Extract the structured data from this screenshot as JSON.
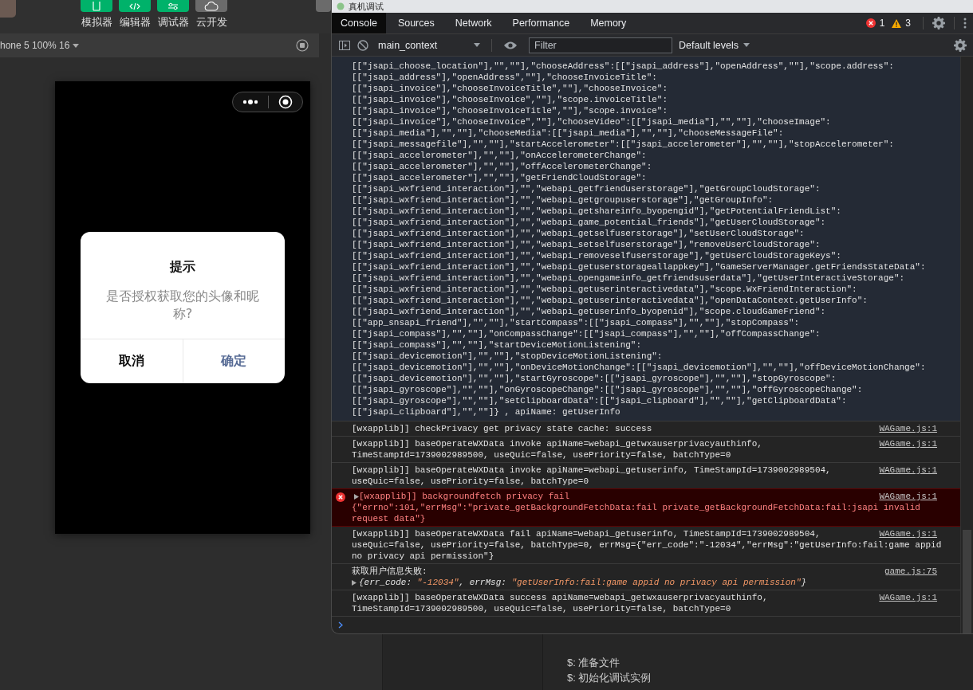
{
  "toolbar": {
    "buttons": [
      {
        "label": "模拟器",
        "on": true
      },
      {
        "label": "编辑器",
        "on": true
      },
      {
        "label": "调试器",
        "on": true
      },
      {
        "label": "云开发",
        "on": false
      }
    ]
  },
  "simulator": {
    "device_menu": "hone 5 100% 16"
  },
  "dialog": {
    "title": "提示",
    "message": "是否授权获取您的头像和昵称?",
    "cancel": "取消",
    "confirm": "确定"
  },
  "devtools": {
    "title": "真机调试",
    "tabs": [
      {
        "label": "Console",
        "selected": true
      },
      {
        "label": "Sources",
        "selected": false
      },
      {
        "label": "Network",
        "selected": false
      },
      {
        "label": "Performance",
        "selected": false
      },
      {
        "label": "Memory",
        "selected": false
      }
    ],
    "error_count": "1",
    "warning_count": "3",
    "context": "main_context",
    "filter": {
      "placeholder": "Filter"
    },
    "levels": "Default levels",
    "messages": [
      {
        "kind": "log",
        "selected": true,
        "lines": [
          "[[\"jsapi_choose_location\"],\"\",\"\"],\"chooseAddress\":[[\"jsapi_address\"],\"openAddress\",\"\"],\"scope.address\":",
          "[[\"jsapi_address\"],\"openAddress\",\"\"],\"chooseInvoiceTitle\":",
          "[[\"jsapi_invoice\"],\"chooseInvoiceTitle\",\"\"],\"chooseInvoice\":",
          "[[\"jsapi_invoice\"],\"chooseInvoice\",\"\"],\"scope.invoiceTitle\":",
          "[[\"jsapi_invoice\"],\"chooseInvoiceTitle\",\"\"],\"scope.invoice\":",
          "[[\"jsapi_invoice\"],\"chooseInvoice\",\"\"],\"chooseVideo\":[[\"jsapi_media\"],\"\",\"\"],\"chooseImage\":",
          "[[\"jsapi_media\"],\"\",\"\"],\"chooseMedia\":[[\"jsapi_media\"],\"\",\"\"],\"chooseMessageFile\":",
          "[[\"jsapi_messagefile\"],\"\",\"\"],\"startAccelerometer\":[[\"jsapi_accelerometer\"],\"\",\"\"],\"stopAccelerometer\":",
          "[[\"jsapi_accelerometer\"],\"\",\"\"],\"onAccelerometerChange\":",
          "[[\"jsapi_accelerometer\"],\"\",\"\"],\"offAccelerometerChange\":",
          "[[\"jsapi_accelerometer\"],\"\",\"\"],\"getFriendCloudStorage\":",
          "[[\"jsapi_wxfriend_interaction\"],\"\",\"webapi_getfrienduserstorage\"],\"getGroupCloudStorage\":",
          "[[\"jsapi_wxfriend_interaction\"],\"\",\"webapi_getgroupuserstorage\"],\"getGroupInfo\":",
          "[[\"jsapi_wxfriend_interaction\"],\"\",\"webapi_getshareinfo_byopengid\"],\"getPotentialFriendList\":",
          "[[\"jsapi_wxfriend_interaction\"],\"\",\"webapi_game_potential_friends\"],\"getUserCloudStorage\":",
          "[[\"jsapi_wxfriend_interaction\"],\"\",\"webapi_getselfuserstorage\"],\"setUserCloudStorage\":",
          "[[\"jsapi_wxfriend_interaction\"],\"\",\"webapi_setselfuserstorage\"],\"removeUserCloudStorage\":",
          "[[\"jsapi_wxfriend_interaction\"],\"\",\"webapi_removeselfuserstorage\"],\"getUserCloudStorageKeys\":",
          "[[\"jsapi_wxfriend_interaction\"],\"\",\"webapi_getuserstorageallappkey\"],\"GameServerManager.getFriendsStateData\":",
          "[[\"jsapi_wxfriend_interaction\"],\"\",\"webapi_opengameinfo_getfriendsuserdata\"],\"getUserInteractiveStorage\":",
          "[[\"jsapi_wxfriend_interaction\"],\"\",\"webapi_getuserinteractivedata\"],\"scope.WxFriendInteraction\":",
          "[[\"jsapi_wxfriend_interaction\"],\"\",\"webapi_getuserinteractivedata\"],\"openDataContext.getUserInfo\":",
          "[[\"jsapi_wxfriend_interaction\"],\"\",\"webapi_getuserinfo_byopenid\"],\"scope.cloudGameFriend\":",
          "[[\"app_snsapi_friend\"],\"\",\"\"],\"startCompass\":[[\"jsapi_compass\"],\"\",\"\"],\"stopCompass\":",
          "[[\"jsapi_compass\"],\"\",\"\"],\"onCompassChange\":[[\"jsapi_compass\"],\"\",\"\"],\"offCompassChange\":",
          "[[\"jsapi_compass\"],\"\",\"\"],\"startDeviceMotionListening\":",
          "[[\"jsapi_devicemotion\"],\"\",\"\"],\"stopDeviceMotionListening\":",
          "[[\"jsapi_devicemotion\"],\"\",\"\"],\"onDeviceMotionChange\":[[\"jsapi_devicemotion\"],\"\",\"\"],\"offDeviceMotionChange\":",
          "[[\"jsapi_devicemotion\"],\"\",\"\"],\"startGyroscope\":[[\"jsapi_gyroscope\"],\"\",\"\"],\"stopGyroscope\":",
          "[[\"jsapi_gyroscope\"],\"\",\"\"],\"onGyroscopeChange\":[[\"jsapi_gyroscope\"],\"\",\"\"],\"offGyroscopeChange\":",
          "[[\"jsapi_gyroscope\"],\"\",\"\"],\"setClipboardData\":[[\"jsapi_clipboard\"],\"\",\"\"],\"getClipboardData\":",
          "[[\"jsapi_clipboard\"],\"\",\"\"]} , apiName: getUserInfo"
        ]
      },
      {
        "kind": "log",
        "selected": false,
        "lines": [
          "[wxapplib]] checkPrivacy get privacy state cache: success"
        ],
        "source": "WAGame.js:1"
      },
      {
        "kind": "log",
        "selected": false,
        "lines": [
          "[wxapplib]] baseOperateWXData invoke apiName=webapi_getwxauserprivacyauthinfo,",
          "TimeStampId=1739002989500, useQuic=false, usePriority=false, batchType=0"
        ],
        "source": "WAGame.js:1"
      },
      {
        "kind": "log",
        "selected": false,
        "lines": [
          "[wxapplib]] baseOperateWXData invoke apiName=webapi_getuserinfo, TimeStampId=1739002989504,",
          "useQuic=false, usePriority=false, batchType=0"
        ],
        "source": "WAGame.js:1"
      },
      {
        "kind": "error",
        "selected": false,
        "lines": [
          "[wxapplib]] backgroundfetch privacy fail",
          "{\"errno\":101,\"errMsg\":\"private_getBackgroundFetchData:fail private_getBackgroundFetchData:fail:jsapi invalid",
          "request data\"}"
        ],
        "source": "WAGame.js:1"
      },
      {
        "kind": "log",
        "selected": false,
        "lines": [
          "[wxapplib]] baseOperateWXData fail apiName=webapi_getuserinfo, TimeStampId=1739002989504,",
          "useQuic=false, usePriority=false, batchType=0, errMsg={\"err_code\":\"-12034\",\"errMsg\":\"getUserInfo:fail:game appid",
          "no privacy api permission\"}"
        ],
        "source": "WAGame.js:1"
      },
      {
        "kind": "object",
        "selected": false,
        "lines": [
          "获取用户信息失败:"
        ],
        "preview": [
          {
            "kind": "key",
            "text": "{err_code: "
          },
          {
            "kind": "string",
            "text": "\"-12034\""
          },
          {
            "kind": "key",
            "text": ", errMsg: "
          },
          {
            "kind": "string",
            "text": "\"getUserInfo:fail:game appid no privacy api permission\""
          },
          {
            "kind": "key",
            "text": "}"
          }
        ],
        "source": "game.js:75"
      },
      {
        "kind": "log",
        "selected": false,
        "lines": [
          "[wxapplib]] baseOperateWXData success apiName=webapi_getwxauserprivacyauthinfo,",
          "TimeStampId=1739002989500, useQuic=false, usePriority=false, batchType=0"
        ],
        "source": "WAGame.js:1"
      }
    ]
  },
  "output": {
    "lines": [
      "$: 准备文件",
      "$: 初始化调试实例"
    ]
  }
}
